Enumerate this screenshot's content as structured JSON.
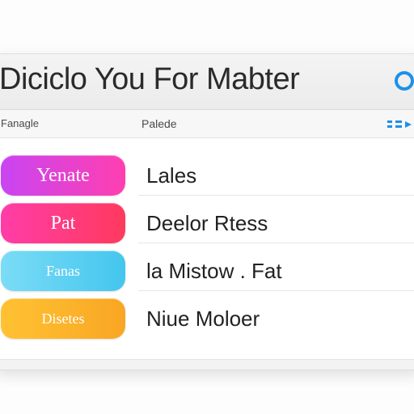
{
  "window": {
    "title": "Diciclo You For Mabter"
  },
  "subheader": {
    "left_label": "Fanagle",
    "middle_label": "Palede"
  },
  "rows": [
    {
      "pill_label": "Yenate",
      "label": "Lales",
      "pill_color": "#d63df0"
    },
    {
      "pill_label": "Pat",
      "label": "Deelor Rtess",
      "pill_color": "#fa3a7e"
    },
    {
      "pill_label": "Fanas",
      "label": "la Mistow . Fat",
      "pill_color": "#5ed0f3"
    },
    {
      "pill_label": "Disetes",
      "label": "Niue Moloer",
      "pill_color": "#fbb72a"
    }
  ],
  "colors": {
    "accent": "#1e90e8"
  },
  "icons": {
    "title_icon": "circle-icon",
    "subheader_icon": "arrows-icon"
  }
}
